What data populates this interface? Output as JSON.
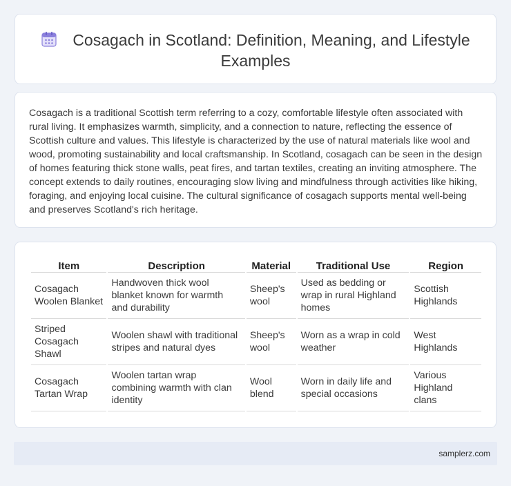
{
  "header": {
    "icon": "calendar-icon",
    "title": "Cosagach in Scotland: Definition, Meaning, and Lifestyle Examples"
  },
  "intro": {
    "text": "Cosagach is a traditional Scottish term referring to a cozy, comfortable lifestyle often associated with rural living. It emphasizes warmth, simplicity, and a connection to nature, reflecting the essence of Scottish culture and values. This lifestyle is characterized by the use of natural materials like wool and wood, promoting sustainability and local craftsmanship. In Scotland, cosagach can be seen in the design of homes featuring thick stone walls, peat fires, and tartan textiles, creating an inviting atmosphere. The concept extends to daily routines, encouraging slow living and mindfulness through activities like hiking, foraging, and enjoying local cuisine. The cultural significance of cosagach supports mental well-being and preserves Scotland's rich heritage."
  },
  "table": {
    "headers": [
      "Item",
      "Description",
      "Material",
      "Traditional Use",
      "Region"
    ],
    "rows": [
      [
        "Cosagach Woolen Blanket",
        "Handwoven thick wool blanket known for warmth and durability",
        "Sheep's wool",
        "Used as bedding or wrap in rural Highland homes",
        "Scottish Highlands"
      ],
      [
        "Striped Cosagach Shawl",
        "Woolen shawl with traditional stripes and natural dyes",
        "Sheep's wool",
        "Worn as a wrap in cold weather",
        "West Highlands"
      ],
      [
        "Cosagach Tartan Wrap",
        "Woolen tartan wrap combining warmth with clan identity",
        "Wool blend",
        "Worn in daily life and special occasions",
        "Various Highland clans"
      ]
    ]
  },
  "footer": {
    "text": "samplerz.com"
  },
  "colors": {
    "page_background": "#f0f3f8",
    "card_background": "#ffffff",
    "footer_background": "#e6ebf5",
    "icon_accent": "#7b6fd6"
  }
}
